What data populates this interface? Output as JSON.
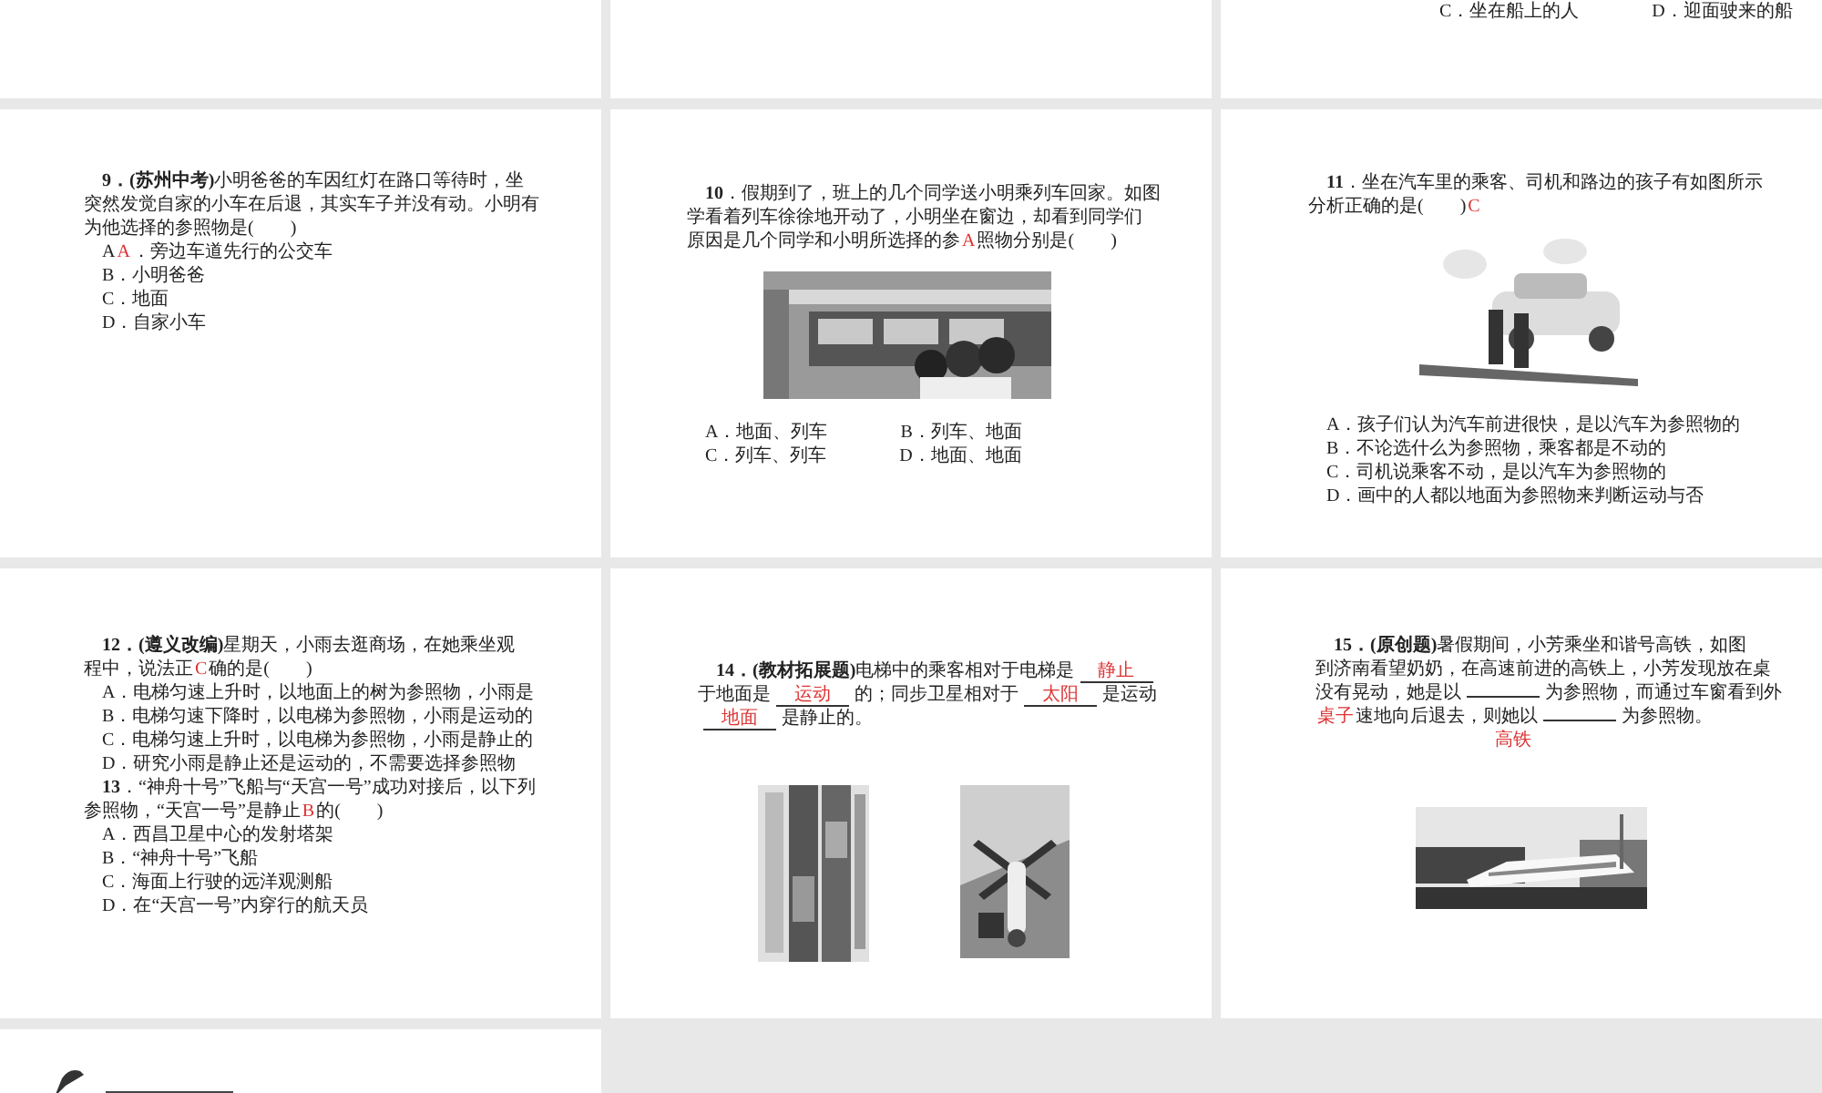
{
  "rows": [
    {
      "slides": [
        {
          "kind": "question"
        },
        {
          "kind": "question"
        },
        {
          "kind": "question",
          "lines": [
            {
              "kind": "option",
              "segments": [
                {
                  "kind": "text",
                  "text": "C．坐在船上的人"
                },
                {
                  "kind": "text",
                  "text": "D．迎面驶来的船"
                }
              ]
            }
          ]
        }
      ]
    },
    {
      "slides": [
        {
          "kind": "question",
          "lines": [
            {
              "kind": "stem",
              "segments": [
                {
                  "kind": "text",
                  "text": "**9．(苏州中考)**小明爸爸的车因红灯在路口等待时，坐"
                }
              ]
            },
            {
              "kind": "cont",
              "segments": [
                {
                  "kind": "text",
                  "text": "突然发觉自家的小车在后退，其实车子并没有动。小明有"
                }
              ]
            },
            {
              "kind": "cont",
              "segments": [
                {
                  "kind": "text",
                  "text": "为他选择的参照物是(　　)"
                }
              ]
            },
            {
              "kind": "option",
              "segments": [
                {
                  "kind": "text",
                  "text": "A"
                },
                {
                  "kind": "mark",
                  "text": "A"
                },
                {
                  "kind": "text",
                  "text": "．旁边车道先行的公交车"
                }
              ]
            },
            {
              "kind": "option",
              "segments": [
                {
                  "kind": "text",
                  "text": "B．小明爸爸"
                }
              ]
            },
            {
              "kind": "option",
              "segments": [
                {
                  "kind": "text",
                  "text": "C．地面"
                }
              ]
            },
            {
              "kind": "option",
              "segments": [
                {
                  "kind": "text",
                  "text": "D．自家小车"
                }
              ]
            }
          ]
        },
        {
          "kind": "question",
          "lines": [
            {
              "kind": "stem",
              "segments": [
                {
                  "kind": "text",
                  "text": "**10**．假期到了，班上的几个同学送小明乘列车回家。如图"
                }
              ]
            },
            {
              "kind": "cont",
              "segments": [
                {
                  "kind": "text",
                  "text": "学看着列车徐徐地开动了，小明坐在窗边，却看到同学们"
                }
              ]
            },
            {
              "kind": "cont",
              "segments": [
                {
                  "kind": "text",
                  "text": "原因是几个同学和小明所选择的参"
                },
                {
                  "kind": "mark",
                  "text": "A"
                },
                {
                  "kind": "text",
                  "text": "照物分别是(　　)"
                }
              ]
            }
          ],
          "figures": [
            {
              "kind": "picture"
            }
          ],
          "after": [
            {
              "kind": "option",
              "segments": [
                {
                  "kind": "text",
                  "text": "A．地面、列车"
                },
                {
                  "kind": "text",
                  "text": "B．列车、地面"
                }
              ]
            },
            {
              "kind": "option",
              "segments": [
                {
                  "kind": "text",
                  "text": "C．列车、列车"
                },
                {
                  "kind": "text",
                  "text": "D．地面、地面"
                }
              ]
            }
          ]
        },
        {
          "kind": "question",
          "lines": [
            {
              "kind": "stem",
              "segments": [
                {
                  "kind": "text",
                  "text": "**11**．坐在汽车里的乘客、司机和路边的孩子有如图所示"
                }
              ]
            },
            {
              "kind": "cont",
              "segments": [
                {
                  "kind": "text",
                  "text": "分析正确的是(　　)"
                },
                {
                  "kind": "mark",
                  "text": "C"
                }
              ]
            }
          ],
          "figures": [
            {
              "kind": "picture"
            }
          ],
          "after": [
            {
              "kind": "option",
              "segments": [
                {
                  "kind": "text",
                  "text": "A．孩子们认为汽车前进很快，是以汽车为参照物的"
                }
              ]
            },
            {
              "kind": "option",
              "segments": [
                {
                  "kind": "text",
                  "text": "B．不论选什么为参照物，乘客都是不动的"
                }
              ]
            },
            {
              "kind": "option",
              "segments": [
                {
                  "kind": "text",
                  "text": "C．司机说乘客不动，是以汽车为参照物的"
                }
              ]
            },
            {
              "kind": "option",
              "segments": [
                {
                  "kind": "text",
                  "text": "D．画中的人都以地面为参照物来判断运动与否"
                }
              ]
            }
          ]
        }
      ]
    },
    {
      "slides": [
        {
          "kind": "question",
          "lines": [
            {
              "kind": "stem",
              "segments": [
                {
                  "kind": "text",
                  "text": "**12．(遵义改编)**星期天，小雨去逛商场，在她乘坐观"
                }
              ]
            },
            {
              "kind": "cont",
              "segments": [
                {
                  "kind": "text",
                  "text": "程中，说法正"
                },
                {
                  "kind": "mark",
                  "text": "C"
                },
                {
                  "kind": "text",
                  "text": "确的是(　　)"
                }
              ]
            },
            {
              "kind": "option",
              "segments": [
                {
                  "kind": "text",
                  "text": "A．电梯匀速上升时，以地面上的树为参照物，小雨是"
                }
              ]
            },
            {
              "kind": "option",
              "segments": [
                {
                  "kind": "text",
                  "text": "B．电梯匀速下降时，以电梯为参照物，小雨是运动的"
                }
              ]
            },
            {
              "kind": "option",
              "segments": [
                {
                  "kind": "text",
                  "text": "C．电梯匀速上升时，以电梯为参照物，小雨是静止的"
                }
              ]
            },
            {
              "kind": "option",
              "segments": [
                {
                  "kind": "text",
                  "text": "D．研究小雨是静止还是运动的，不需要选择参照物"
                }
              ]
            },
            {
              "kind": "stem",
              "segments": [
                {
                  "kind": "text",
                  "text": "**13**．“神舟十号”飞船与“天宫一号”成功对接后，以下列"
                }
              ]
            },
            {
              "kind": "cont",
              "segments": [
                {
                  "kind": "text",
                  "text": "参照物，“天宫一号”是静止"
                },
                {
                  "kind": "mark",
                  "text": "B"
                },
                {
                  "kind": "text",
                  "text": "的(　　)"
                }
              ]
            },
            {
              "kind": "option",
              "segments": [
                {
                  "kind": "text",
                  "text": "A．西昌卫星中心的发射塔架"
                }
              ]
            },
            {
              "kind": "option",
              "segments": [
                {
                  "kind": "text",
                  "text": "B．“神舟十号”飞船"
                }
              ]
            },
            {
              "kind": "option",
              "segments": [
                {
                  "kind": "text",
                  "text": "C．海面上行驶的远洋观测船"
                }
              ]
            },
            {
              "kind": "option",
              "segments": [
                {
                  "kind": "text",
                  "text": "D．在“天宫一号”内穿行的航天员"
                }
              ]
            }
          ]
        },
        {
          "kind": "question",
          "lines": [
            {
              "kind": "stem",
              "segments": [
                {
                  "kind": "text",
                  "text": "**14．(教材拓展题)**电梯中的乘客相对于电梯是"
                },
                {
                  "kind": "blank",
                  "answer": "静止"
                }
              ]
            },
            {
              "kind": "cont",
              "segments": [
                {
                  "kind": "text",
                  "text": "于地面是"
                },
                {
                  "kind": "blank",
                  "answer": "运动"
                },
                {
                  "kind": "text",
                  "text": "的；同步卫星相对于"
                },
                {
                  "kind": "blank",
                  "answer": "太阳"
                },
                {
                  "kind": "text",
                  "text": "是运动"
                }
              ]
            },
            {
              "kind": "cont",
              "segments": [
                {
                  "kind": "blank",
                  "answer": "地面"
                },
                {
                  "kind": "text",
                  "text": "是静止的。"
                }
              ]
            }
          ],
          "figures": [
            {
              "kind": "picture"
            },
            {
              "kind": "picture"
            }
          ]
        },
        {
          "kind": "question",
          "lines": [
            {
              "kind": "stem",
              "segments": [
                {
                  "kind": "text",
                  "text": "**15．(原创题)**暑假期间，小芳乘坐和谐号高铁，如图"
                }
              ]
            },
            {
              "kind": "cont",
              "segments": [
                {
                  "kind": "text",
                  "text": "到济南看望奶奶，在高速前进的高铁上，小芳发现放在桌"
                }
              ]
            },
            {
              "kind": "cont",
              "segments": [
                {
                  "kind": "text",
                  "text": "没有晃动，她是以"
                },
                {
                  "kind": "blank"
                },
                {
                  "kind": "text",
                  "text": "为参照物，而通过车窗看到外"
                }
              ]
            },
            {
              "kind": "cont",
              "segments": [
                {
                  "kind": "mark",
                  "text": "桌子"
                },
                {
                  "kind": "text",
                  "text": "速地向后退去，则她以"
                },
                {
                  "kind": "blank"
                },
                {
                  "kind": "text",
                  "text": "为参照物。"
                }
              ]
            },
            {
              "kind": "answer",
              "segments": [
                {
                  "kind": "mark",
                  "text": "高铁"
                }
              ]
            }
          ],
          "figures": [
            {
              "kind": "picture"
            }
          ]
        }
      ]
    },
    {
      "slides": [
        {
          "kind": "pen"
        }
      ]
    }
  ]
}
